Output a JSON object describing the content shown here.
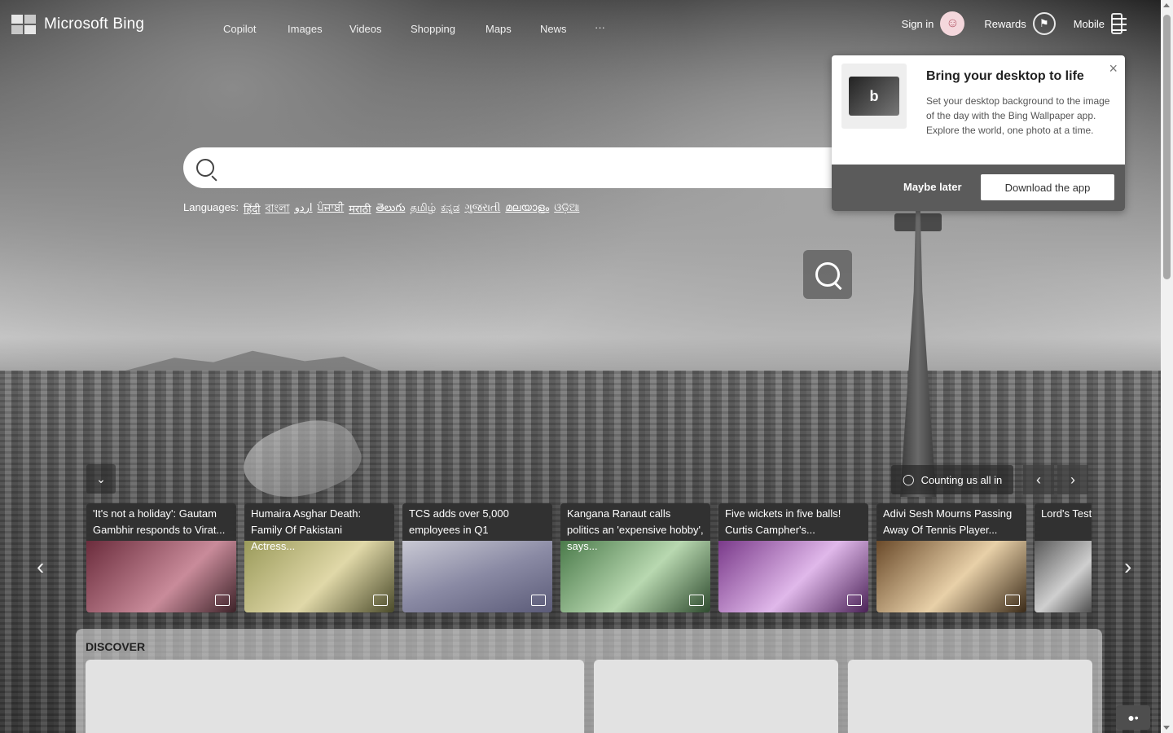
{
  "header": {
    "logo_text": "Microsoft Bing",
    "nav": [
      "Copilot",
      "Images",
      "Videos",
      "Shopping",
      "Maps",
      "News",
      "···"
    ],
    "sign_in": "Sign in",
    "rewards": "Rewards",
    "mobile": "Mobile"
  },
  "search": {
    "placeholder": "",
    "languages_label": "Languages:",
    "languages": [
      "हिंदी",
      "বাংলা",
      "اردو",
      "ਪੰਜਾਬੀ",
      "मराठी",
      "తెలుగు",
      "தமிழ்",
      "ಕನ್ನಡ",
      "ગુજરાતી",
      "മലയാളം",
      "ଓଡ଼ିଆ"
    ]
  },
  "popup": {
    "title": "Bring your desktop to life",
    "body": "Set your desktop background to the image of the day with the Bing Wallpaper app. Explore the world, one photo at a time.",
    "later": "Maybe later",
    "download": "Download the app",
    "close": "×"
  },
  "news": {
    "location": "Counting us all in",
    "cards": [
      {
        "title": "'It's not a holiday': Gautam Gambhir responds to Virat..."
      },
      {
        "title": "Humaira Asghar Death: Family Of Pakistani Actress..."
      },
      {
        "title": "TCS adds over 5,000 employees in Q1"
      },
      {
        "title": "Kangana Ranaut calls politics an 'expensive hobby', says..."
      },
      {
        "title": "Five wickets in five balls! Curtis Campher's..."
      },
      {
        "title": "Adivi Sesh Mourns Passing Away Of Tennis Player..."
      },
      {
        "title": "Lord's Test: Jurel keepi..."
      }
    ]
  },
  "discover": {
    "heading": "DISCOVER"
  },
  "colors": {
    "popup_footer": "#5b5b5b",
    "search_bg": "#ffffff"
  }
}
